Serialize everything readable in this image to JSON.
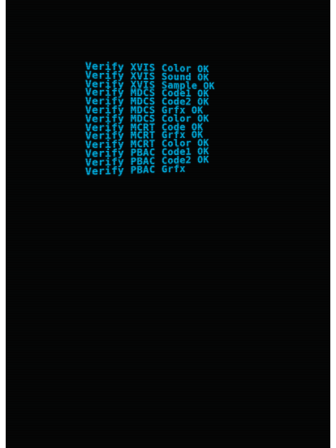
{
  "screen": {
    "background_color": "#050606",
    "text_color": "#00a6d6"
  },
  "log": [
    "Verify XVIS Color OK",
    "Verify XVIS Sound OK",
    "Verify XVIS Sample OK",
    "Verify MDCS Code1 OK",
    "Verify MDCS Code2 OK",
    "Verify MDCS Grfx OK",
    "Verify MDCS Color OK",
    "Verify MCRT Code OK",
    "Verify MCRT Grfx OK",
    "Verify MCRT Color OK",
    "Verify PBAC Code1 OK",
    "Verify PBAC Code2 OK",
    "Verify PBAC Grfx"
  ]
}
